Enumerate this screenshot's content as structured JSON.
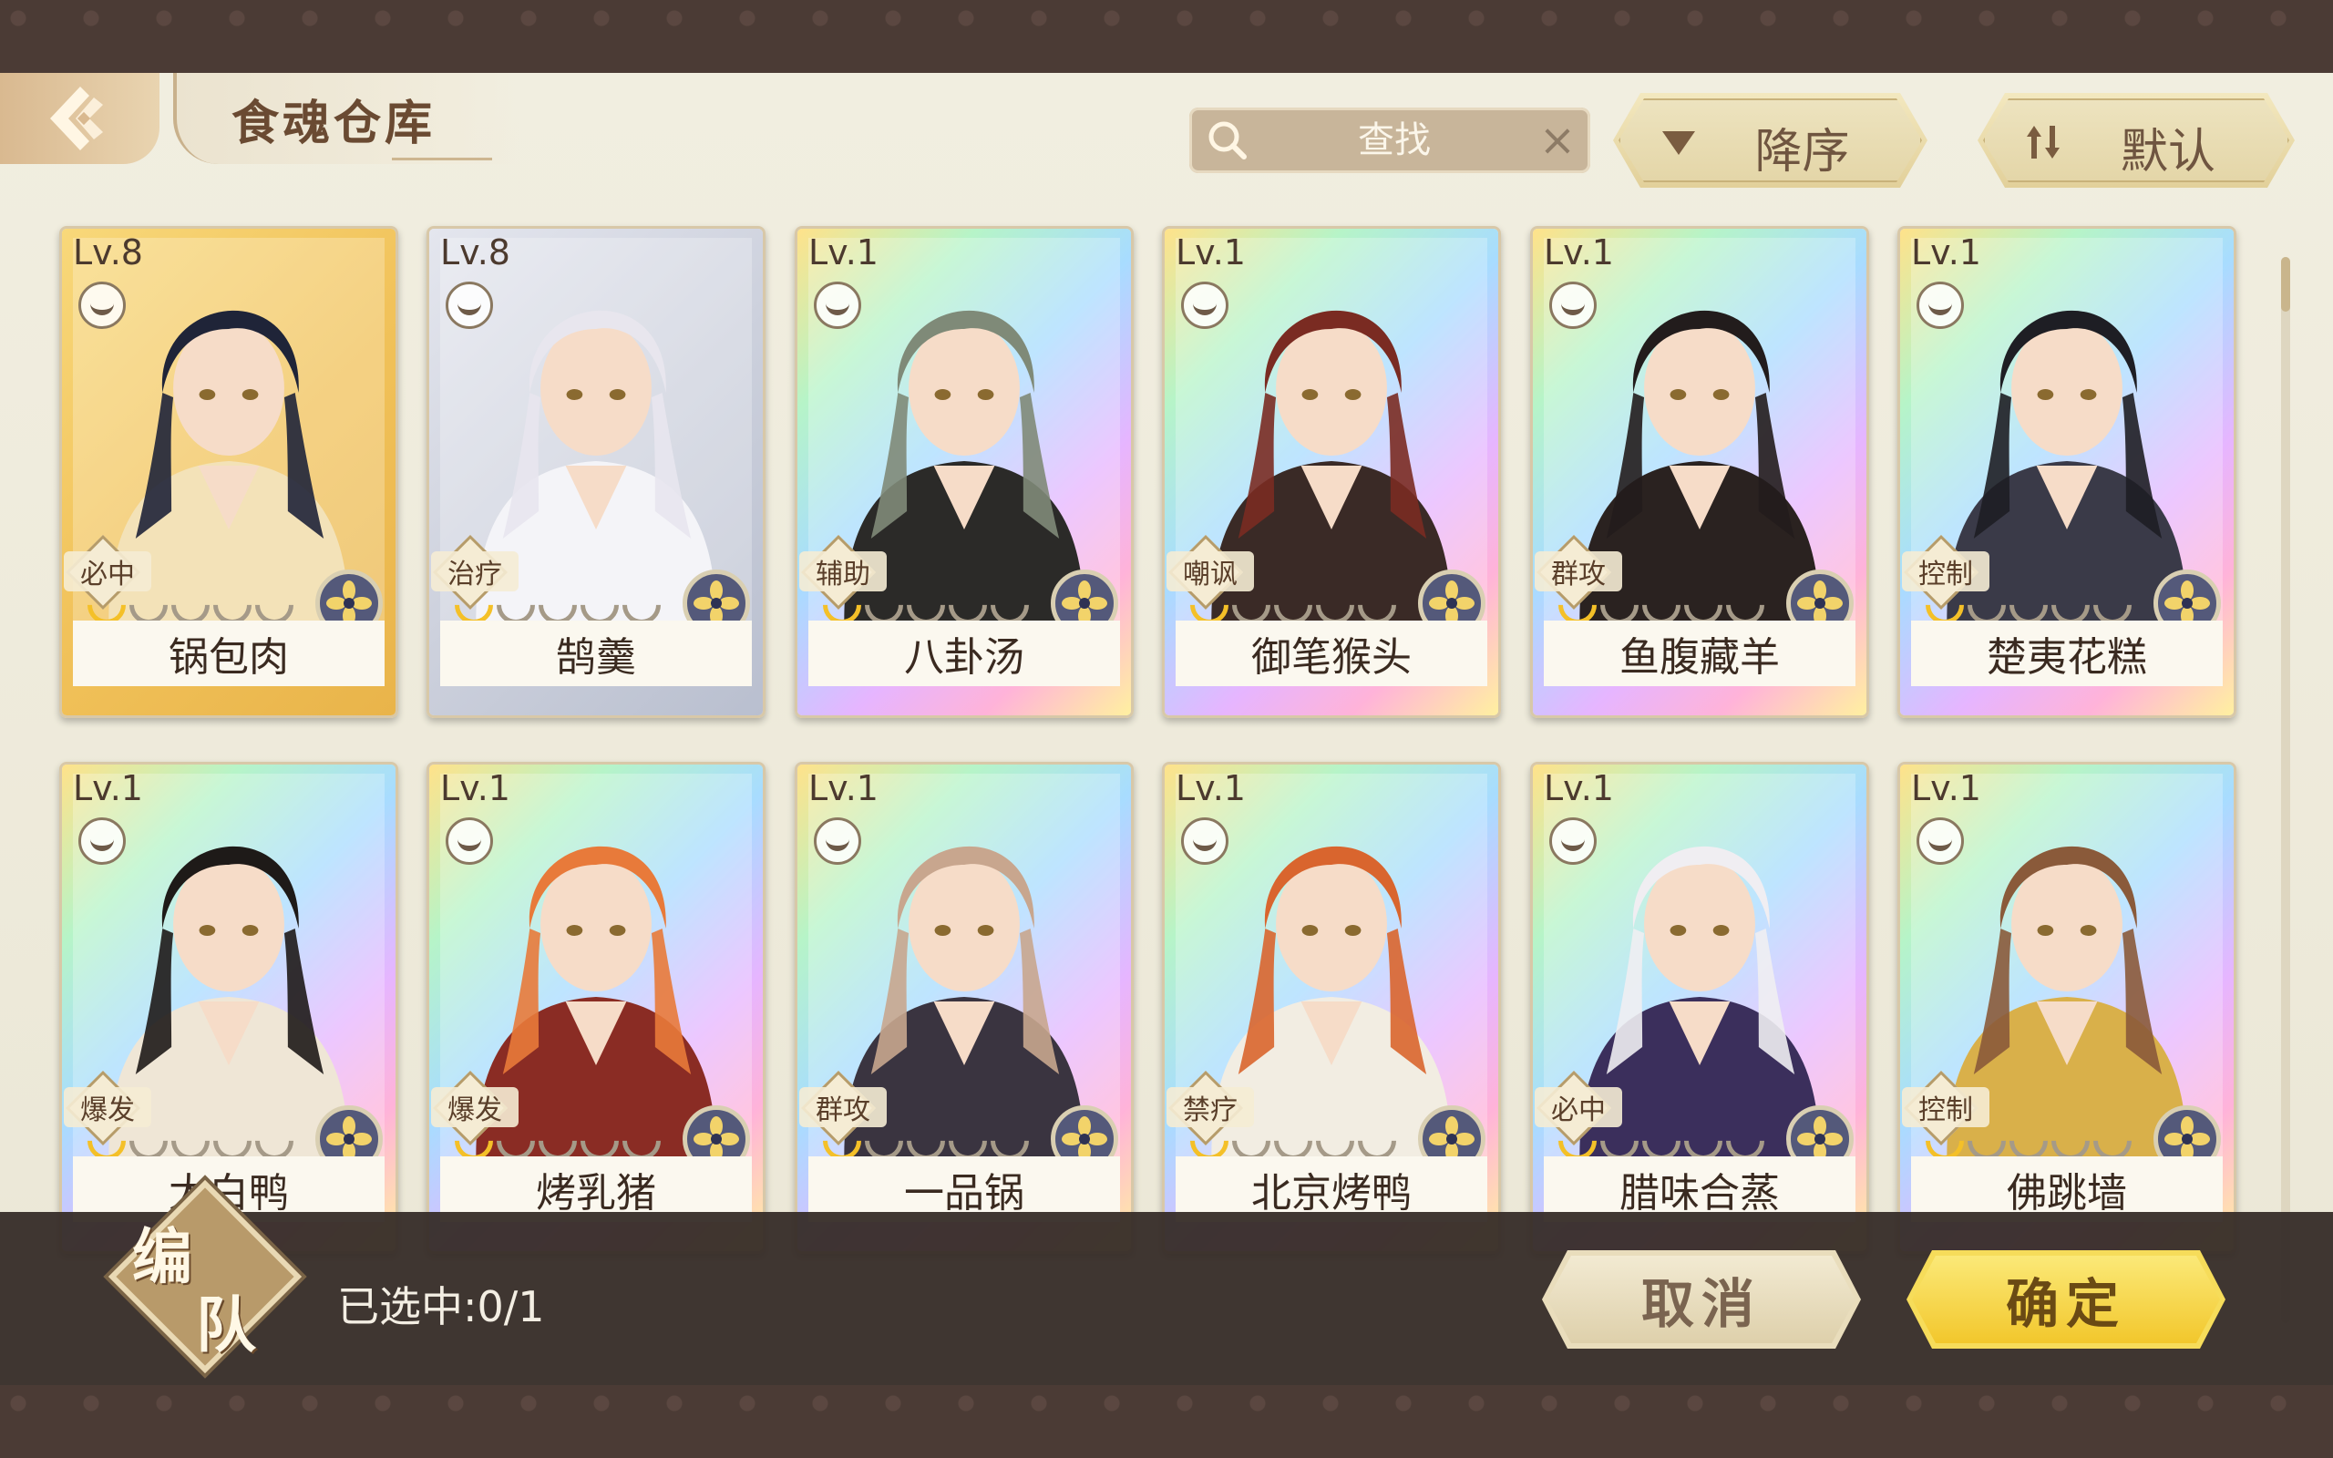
{
  "header": {
    "title": "食魂仓库",
    "search_placeholder": "查找",
    "sort_order_label": "降序",
    "sort_mode_label": "默认"
  },
  "cards": [
    {
      "level": "Lv.8",
      "role": "必中",
      "name": "锅包肉",
      "stars": 1,
      "frame": "gold"
    },
    {
      "level": "Lv.8",
      "role": "治疗",
      "name": "鹄羹",
      "stars": 1,
      "frame": "silver"
    },
    {
      "level": "Lv.1",
      "role": "辅助",
      "name": "八卦汤",
      "stars": 1,
      "frame": "rainbow"
    },
    {
      "level": "Lv.1",
      "role": "嘲讽",
      "name": "御笔猴头",
      "stars": 1,
      "frame": "rainbow"
    },
    {
      "level": "Lv.1",
      "role": "群攻",
      "name": "鱼腹藏羊",
      "stars": 1,
      "frame": "rainbow"
    },
    {
      "level": "Lv.1",
      "role": "控制",
      "name": "楚夷花糕",
      "stars": 1,
      "frame": "rainbow"
    },
    {
      "level": "Lv.1",
      "role": "爆发",
      "name": "太白鸭",
      "stars": 1,
      "frame": "rainbow"
    },
    {
      "level": "Lv.1",
      "role": "爆发",
      "name": "烤乳猪",
      "stars": 1,
      "frame": "rainbow"
    },
    {
      "level": "Lv.1",
      "role": "群攻",
      "name": "一品锅",
      "stars": 1,
      "frame": "rainbow"
    },
    {
      "level": "Lv.1",
      "role": "禁疗",
      "name": "北京烤鸭",
      "stars": 1,
      "frame": "rainbow"
    },
    {
      "level": "Lv.1",
      "role": "必中",
      "name": "腊味合蒸",
      "stars": 1,
      "frame": "rainbow"
    },
    {
      "level": "Lv.1",
      "role": "控制",
      "name": "佛跳墙",
      "stars": 1,
      "frame": "rainbow"
    }
  ],
  "footer": {
    "team_char_1": "编",
    "team_char_2": "队",
    "selected_text": "已选中:0/1",
    "cancel_label": "取消",
    "confirm_label": "确定"
  },
  "colors": {
    "accent_gold": "#f2c72c",
    "frame_dark": "#4b3b35",
    "panel_bg": "#ebe7d6"
  }
}
